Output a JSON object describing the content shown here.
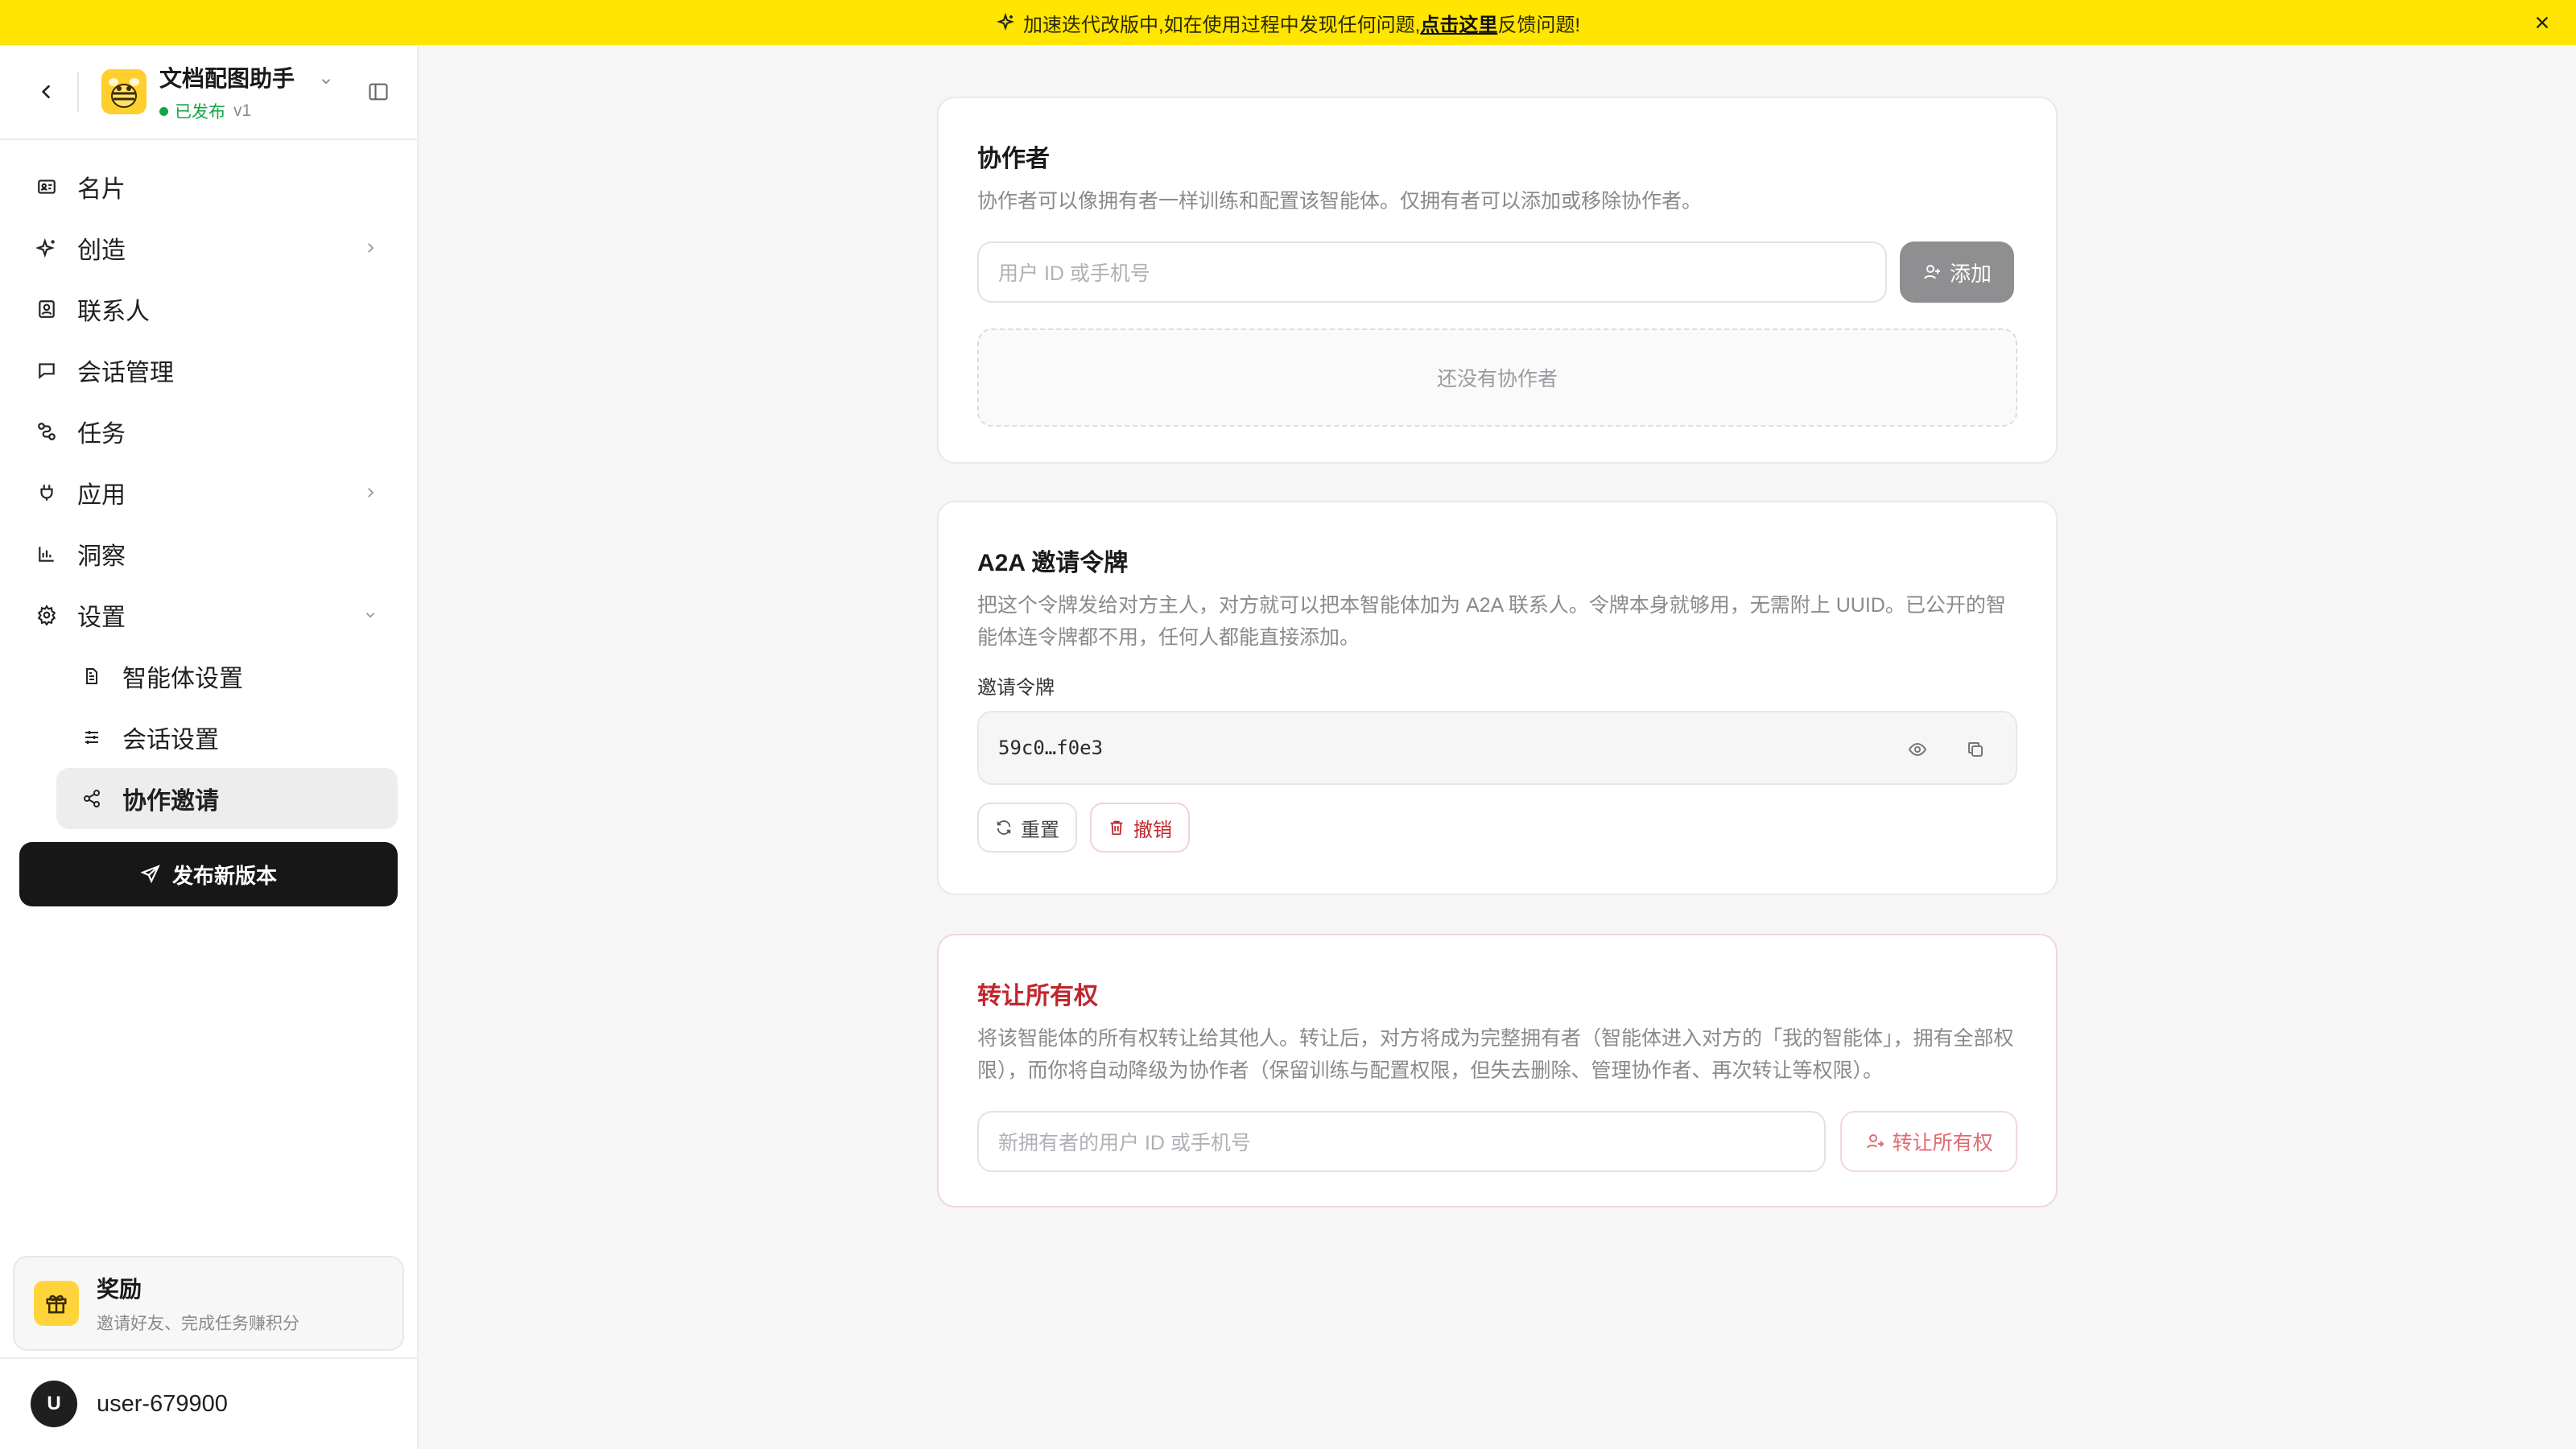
{
  "banner": {
    "text_before": "加速迭代改版中,如在使用过程中发现任何问题,",
    "link": "点击这里",
    "text_after": "反馈问题!"
  },
  "agent": {
    "name": "文档配图助手",
    "status": "已发布",
    "version": "v1"
  },
  "nav": {
    "items": [
      {
        "label": "名片",
        "icon": "id-card-icon"
      },
      {
        "label": "创造",
        "icon": "sparkle-icon"
      },
      {
        "label": "联系人",
        "icon": "contact-icon"
      },
      {
        "label": "会话管理",
        "icon": "chat-bubble-icon"
      },
      {
        "label": "任务",
        "icon": "workflow-icon"
      },
      {
        "label": "应用",
        "icon": "plug-icon"
      },
      {
        "label": "洞察",
        "icon": "bar-chart-icon"
      },
      {
        "label": "设置",
        "icon": "gear-icon"
      }
    ],
    "sub_items": [
      {
        "label": "智能体设置",
        "icon": "document-icon"
      },
      {
        "label": "会话设置",
        "icon": "sliders-icon"
      },
      {
        "label": "协作邀请",
        "icon": "share-icon"
      }
    ],
    "publish_label": "发布新版本"
  },
  "reward": {
    "title": "奖励",
    "subtitle": "邀请好友、完成任务赚积分"
  },
  "user": {
    "initial": "U",
    "name": "user-679900"
  },
  "collaborators": {
    "title": "协作者",
    "description": "协作者可以像拥有者一样训练和配置该智能体。仅拥有者可以添加或移除协作者。",
    "input_placeholder": "用户 ID 或手机号",
    "add_label": "添加",
    "empty_text": "还没有协作者"
  },
  "a2a": {
    "title": "A2A 邀请令牌",
    "description": "把这个令牌发给对方主人，对方就可以把本智能体加为 A2A 联系人。令牌本身就够用，无需附上 UUID。已公开的智能体连令牌都不用，任何人都能直接添加。",
    "token_label": "邀请令牌",
    "token_value": "59c0…f0e3",
    "reset_label": "重置",
    "revoke_label": "撤销"
  },
  "transfer": {
    "title": "转让所有权",
    "description": "将该智能体的所有权转让给其他人。转让后，对方将成为完整拥有者（智能体进入对方的「我的智能体」，拥有全部权限），而你将自动降级为协作者（保留训练与配置权限，但失去删除、管理协作者、再次转让等权限）。",
    "input_placeholder": "新拥有者的用户 ID 或手机号",
    "button_label": "转让所有权"
  },
  "colors": {
    "banner": "#ffe500",
    "accent_dark": "#171717",
    "published_green": "#16a34a",
    "danger_red": "#c0262d"
  }
}
